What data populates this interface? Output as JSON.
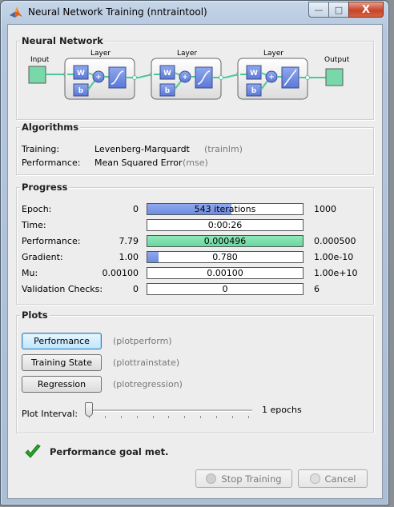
{
  "window": {
    "title": "Neural Network Training (nntraintool)",
    "controls": {
      "minimize": "—",
      "maximize": "□",
      "close": "X"
    }
  },
  "neural_network": {
    "legend": "Neural Network",
    "input_label": "Input",
    "output_label": "Output",
    "layers": [
      {
        "label": "Layer",
        "weight": "W",
        "bias": "b",
        "sum": "+",
        "transfer": "tansig"
      },
      {
        "label": "Layer",
        "weight": "W",
        "bias": "b",
        "sum": "+",
        "transfer": "tansig"
      },
      {
        "label": "Layer",
        "weight": "W",
        "bias": "b",
        "sum": "+",
        "transfer": "purelin"
      }
    ]
  },
  "algorithms": {
    "legend": "Algorithms",
    "rows": [
      {
        "label": "Training:",
        "value": "Levenberg-Marquardt",
        "hint": "(trainlm)"
      },
      {
        "label": "Performance:",
        "value": "Mean Squared Error",
        "hint": "(mse)"
      }
    ]
  },
  "progress": {
    "legend": "Progress",
    "rows": [
      {
        "label": "Epoch:",
        "left": "0",
        "bar_text": "543 iterations",
        "right": "1000",
        "fill": 0.543,
        "color": "blue"
      },
      {
        "label": "Time:",
        "left": "",
        "bar_text": "0:00:26",
        "right": "",
        "fill": 0,
        "color": "blue"
      },
      {
        "label": "Performance:",
        "left": "7.79",
        "bar_text": "0.000496",
        "right": "0.000500",
        "fill": 1.0,
        "color": "green"
      },
      {
        "label": "Gradient:",
        "left": "1.00",
        "bar_text": "0.780",
        "right": "1.00e-10",
        "fill": 0.07,
        "color": "blue"
      },
      {
        "label": "Mu:",
        "left": "0.00100",
        "bar_text": "0.00100",
        "right": "1.00e+10",
        "fill": 0,
        "color": "blue"
      },
      {
        "label": "Validation Checks:",
        "left": "0",
        "bar_text": "0",
        "right": "6",
        "fill": 0,
        "color": "blue"
      }
    ]
  },
  "plots": {
    "legend": "Plots",
    "buttons": [
      {
        "label": "Performance",
        "hint": "(plotperform)"
      },
      {
        "label": "Training State",
        "hint": "(plottrainstate)"
      },
      {
        "label": "Regression",
        "hint": "(plotregression)"
      }
    ],
    "plot_interval_label": "Plot Interval:",
    "plot_interval_value": "1 epochs",
    "plot_interval_level": 0
  },
  "status": {
    "message": "Performance goal met.",
    "color": "#2aa02a"
  },
  "footer": {
    "stop_label": "Stop Training",
    "cancel_label": "Cancel"
  }
}
